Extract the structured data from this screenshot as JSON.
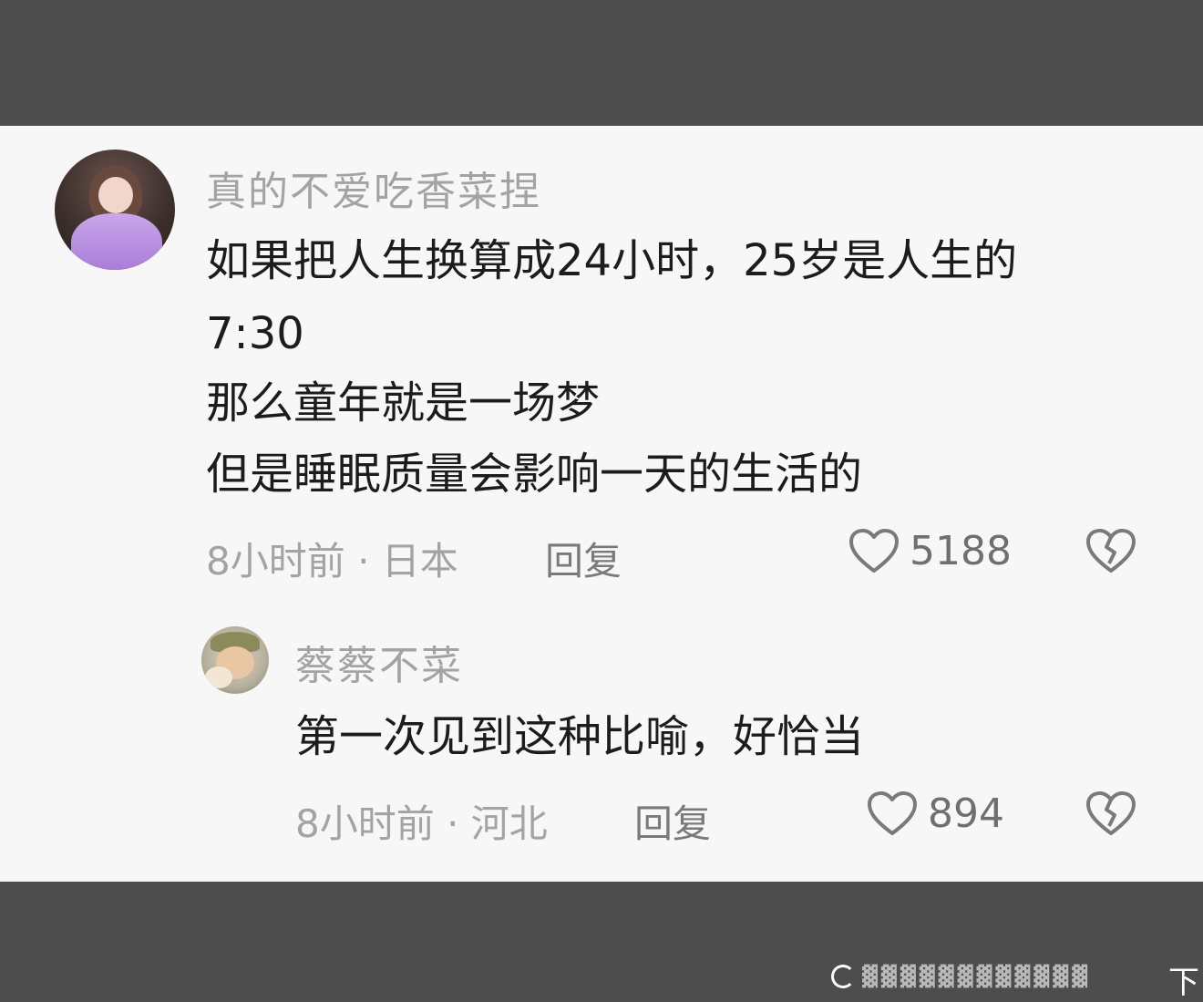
{
  "comments": [
    {
      "username": "真的不爱吃香菜捏",
      "lines": [
        "如果把人生换算成24小时，25岁是人生的",
        "7:30",
        "那么童年就是一场梦",
        "但是睡眠质量会影响一天的生活的"
      ],
      "meta": "8小时前 · 日本",
      "reply_label": "回复",
      "likes": "5188",
      "like_icon": "heart-outline-icon",
      "dislike_icon": "broken-heart-icon"
    },
    {
      "username": "蔡蔡不菜",
      "lines": [
        "第一次见到这种比喻，好恰当"
      ],
      "meta": "8小时前 · 河北",
      "reply_label": "回复",
      "likes": "894",
      "like_icon": "heart-outline-icon",
      "dislike_icon": "broken-heart-icon"
    }
  ],
  "watermark": {
    "mark": "下"
  },
  "colors": {
    "background_band": "#4d4d4d",
    "card": "#f7f7f7",
    "text_primary": "#1c1c1c",
    "text_secondary": "#a3a3a3"
  }
}
